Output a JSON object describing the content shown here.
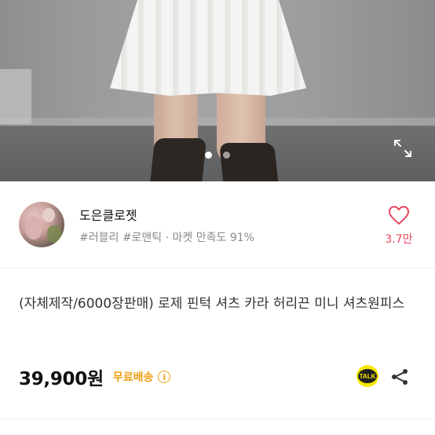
{
  "hero": {
    "image_alt": "product photo",
    "carousel_total": 2,
    "carousel_active": 0,
    "expand_icon": "expand-icon"
  },
  "seller": {
    "name": "도은클로젯",
    "meta": "#러블리 #로맨틱 · 마켓 만족도 91%",
    "like_icon": "heart-icon",
    "like_count": "3.7만"
  },
  "product": {
    "title": "(자체제작/6000장판매) 로제 핀턱 셔츠 카라 허리끈 미니 셔츠원피스",
    "price": "39,900원",
    "shipping": "무료배송",
    "info_icon": "i",
    "talk_label": "TALK",
    "share_icon": "share-icon"
  },
  "colors": {
    "accent_like": "#e8475f",
    "shipping": "#f0a013",
    "talk_bg": "#1f1f1f",
    "talk_text": "#f7e600"
  }
}
